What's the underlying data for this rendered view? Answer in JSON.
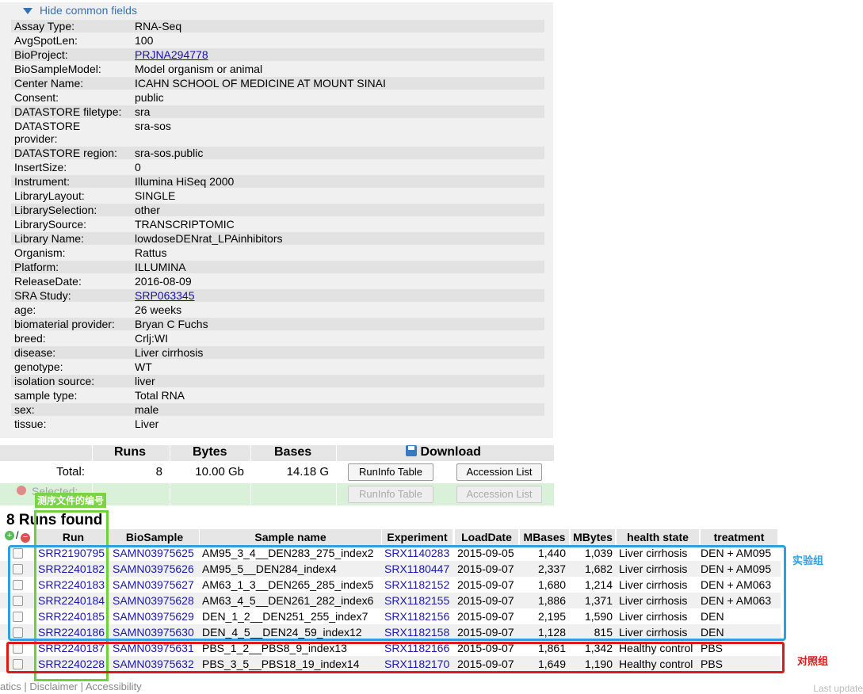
{
  "toggle": {
    "label": "Hide common fields"
  },
  "fields": [
    {
      "k": "Assay Type:",
      "v": "RNA-Seq"
    },
    {
      "k": "AvgSpotLen:",
      "v": "100"
    },
    {
      "k": "BioProject:",
      "v": "PRJNA294778",
      "link": true
    },
    {
      "k": "BioSampleModel:",
      "v": "Model organism or animal"
    },
    {
      "k": "Center Name:",
      "v": "ICAHN SCHOOL OF MEDICINE AT MOUNT SINAI"
    },
    {
      "k": "Consent:",
      "v": "public"
    },
    {
      "k": "DATASTORE filetype:",
      "v": "sra"
    },
    {
      "k": "DATASTORE provider:",
      "v": "sra-sos"
    },
    {
      "k": "DATASTORE region:",
      "v": "sra-sos.public"
    },
    {
      "k": "InsertSize:",
      "v": "0"
    },
    {
      "k": "Instrument:",
      "v": "Illumina HiSeq 2000"
    },
    {
      "k": "LibraryLayout:",
      "v": "SINGLE"
    },
    {
      "k": "LibrarySelection:",
      "v": "other"
    },
    {
      "k": "LibrarySource:",
      "v": "TRANSCRIPTOMIC"
    },
    {
      "k": "Library Name:",
      "v": "lowdoseDENrat_LPAinhibitors"
    },
    {
      "k": "Organism:",
      "v": "Rattus"
    },
    {
      "k": "Platform:",
      "v": "ILLUMINA"
    },
    {
      "k": "ReleaseDate:",
      "v": "2016-08-09"
    },
    {
      "k": "SRA Study:",
      "v": "SRP063345",
      "link": true
    },
    {
      "k": "age:",
      "v": "26 weeks"
    },
    {
      "k": "biomaterial provider:",
      "v": "Bryan C Fuchs"
    },
    {
      "k": "breed:",
      "v": "Crlj:WI"
    },
    {
      "k": "disease:",
      "v": "Liver cirrhosis"
    },
    {
      "k": "genotype:",
      "v": "WT"
    },
    {
      "k": "isolation source:",
      "v": "liver"
    },
    {
      "k": "sample type:",
      "v": "Total RNA"
    },
    {
      "k": "sex:",
      "v": "male"
    },
    {
      "k": "tissue:",
      "v": "Liver"
    }
  ],
  "summary": {
    "headers": {
      "runs": "Runs",
      "bytes": "Bytes",
      "bases": "Bases",
      "download": "Download"
    },
    "total_label": "Total:",
    "runs": "8",
    "bytes": "10.00 Gb",
    "bases": "14.18 G",
    "selected_label": "Selected:",
    "runinfo_btn": "RunInfo Table",
    "accession_btn": "Accession List"
  },
  "annotations": {
    "green": "测序文件的编号",
    "blue": "实验组",
    "red": "对照组"
  },
  "runs_title": "8 Runs found",
  "table": {
    "headers": [
      "Run",
      "BioSample",
      "Sample name",
      "Experiment",
      "LoadDate",
      "MBases",
      "MBytes",
      "health state",
      "treatment"
    ],
    "rows": [
      [
        "SRR2190795",
        "SAMN03975625",
        "AM95_3_4__DEN283_275_index2",
        "SRX1140283",
        "2015-09-05",
        "1,440",
        "1,039",
        "Liver cirrhosis",
        "DEN + AM095"
      ],
      [
        "SRR2240182",
        "SAMN03975626",
        "AM95_5__DEN284_index4",
        "SRX1180447",
        "2015-09-07",
        "2,337",
        "1,682",
        "Liver cirrhosis",
        "DEN + AM095"
      ],
      [
        "SRR2240183",
        "SAMN03975627",
        "AM63_1_3__DEN265_285_index5",
        "SRX1182152",
        "2015-09-07",
        "1,680",
        "1,214",
        "Liver cirrhosis",
        "DEN + AM063"
      ],
      [
        "SRR2240184",
        "SAMN03975628",
        "AM63_4_5__DEN261_282_index6",
        "SRX1182155",
        "2015-09-07",
        "1,886",
        "1,371",
        "Liver cirrhosis",
        "DEN + AM063"
      ],
      [
        "SRR2240185",
        "SAMN03975629",
        "DEN_1_2__DEN251_255_index7",
        "SRX1182156",
        "2015-09-07",
        "2,195",
        "1,590",
        "Liver cirrhosis",
        "DEN"
      ],
      [
        "SRR2240186",
        "SAMN03975630",
        "DEN_4_5__DEN24_59_index12",
        "SRX1182158",
        "2015-09-07",
        "1,128",
        "815",
        "Liver cirrhosis",
        "DEN"
      ],
      [
        "SRR2240187",
        "SAMN03975631",
        "PBS_1_2__PBS8_9_index13",
        "SRX1182166",
        "2015-09-07",
        "1,861",
        "1,342",
        "Healthy control",
        "PBS"
      ],
      [
        "SRR2240228",
        "SAMN03975632",
        "PBS_3_5__PBS18_19_index14",
        "SRX1182170",
        "2015-09-07",
        "1,649",
        "1,190",
        "Healthy control",
        "PBS"
      ]
    ]
  },
  "footer": {
    "links": "atics | Disclaimer | Accessibility",
    "right": "Last update"
  }
}
